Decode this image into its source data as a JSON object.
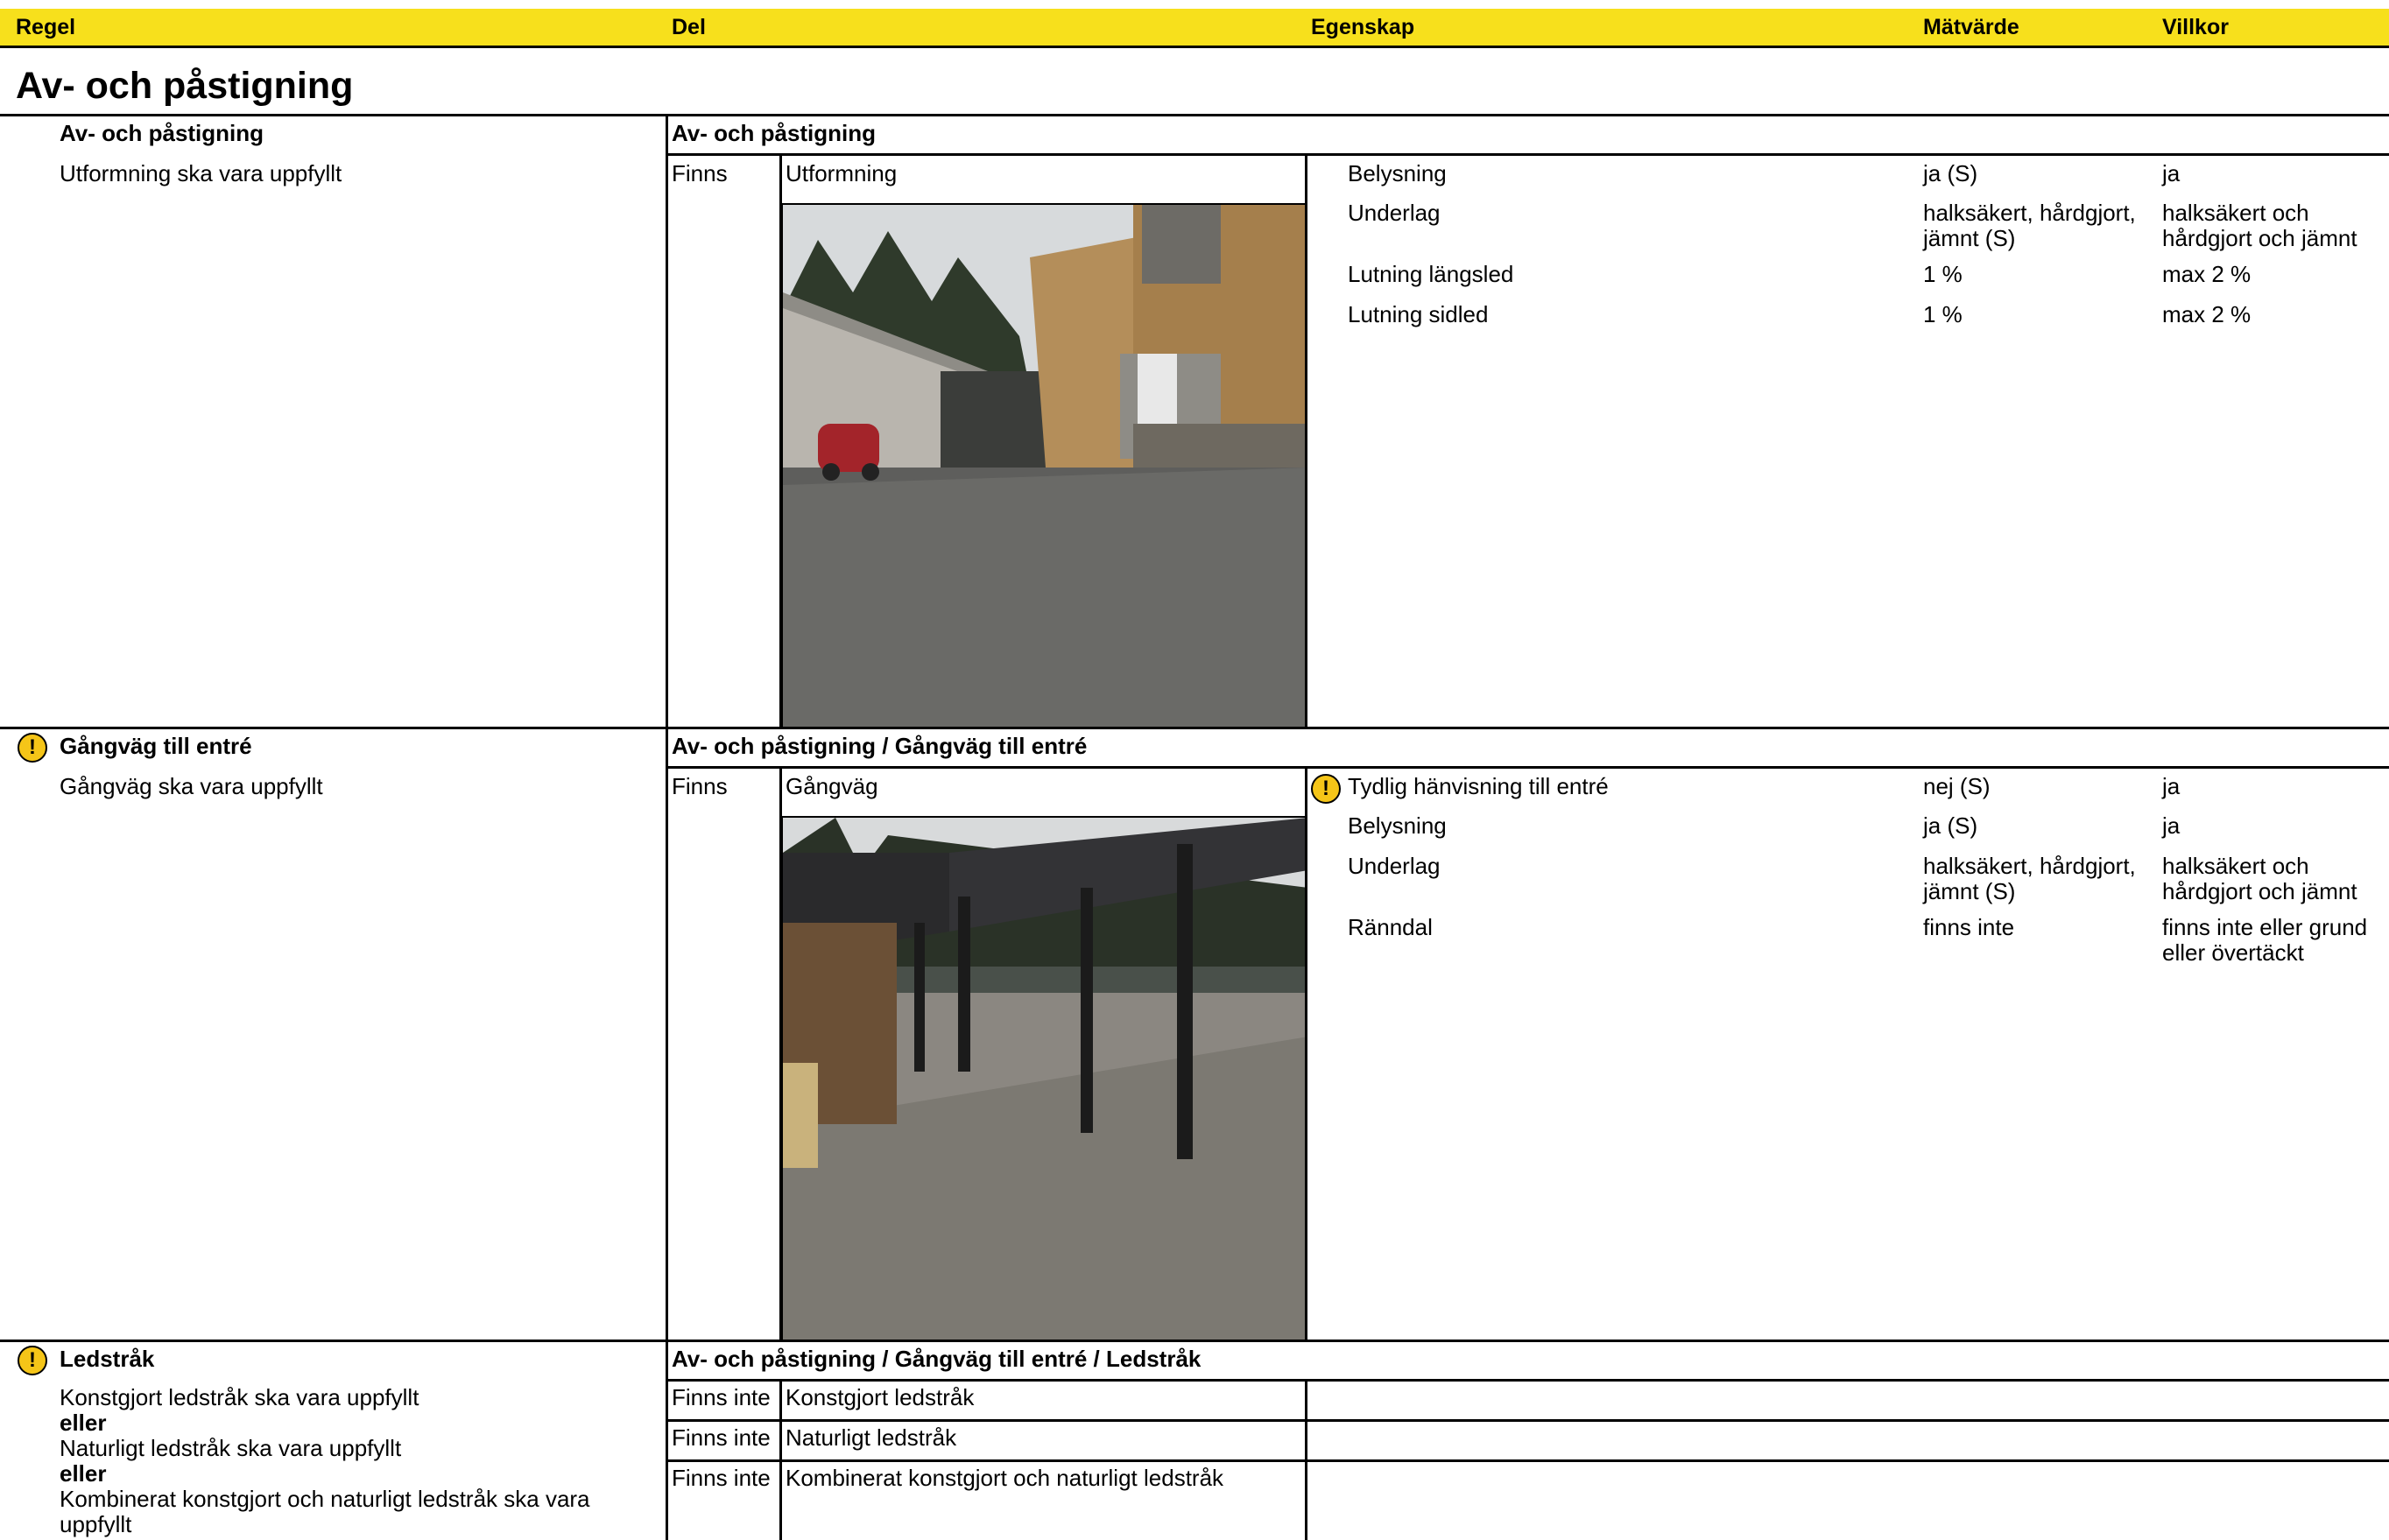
{
  "header": {
    "regel": "Regel",
    "del": "Del",
    "egenskap": "Egenskap",
    "matvarde": "Mätvärde",
    "villkor": "Villkor"
  },
  "section_title": "Av- och påstigning",
  "colors": {
    "header_bg": "#f7e01c",
    "warning": "#f5c518"
  },
  "rules": [
    {
      "title": "Av- och påstigning",
      "text": "Utformning ska vara uppfyllt",
      "path": "Av- och påstigning",
      "status": "Finns",
      "part": "Utformning",
      "properties": [
        {
          "name": "Belysning",
          "value": "ja (S)",
          "cond": "ja"
        },
        {
          "name": "Underlag",
          "value": "halksäkert, hårdgjort,",
          "value2": "jämnt (S)",
          "cond": "halksäkert och",
          "cond2": "hårdgjort och jämnt"
        },
        {
          "name": "Lutning längsled",
          "value": "1 %",
          "cond": "max 2 %"
        },
        {
          "name": "Lutning sidled",
          "value": "1 %",
          "cond": "max 2 %"
        }
      ]
    },
    {
      "title": "Gångväg till entré",
      "text": "Gångväg ska vara uppfyllt",
      "path": "Av- och påstigning / Gångväg till entré",
      "status": "Finns",
      "part": "Gångväg",
      "properties": [
        {
          "name": "Tydlig hänvisning till entré",
          "value": "nej (S)",
          "cond": "ja"
        },
        {
          "name": "Belysning",
          "value": "ja (S)",
          "cond": "ja"
        },
        {
          "name": "Underlag",
          "value": "halksäkert, hårdgjort,",
          "value2": "jämnt (S)",
          "cond": "halksäkert och",
          "cond2": "hårdgjort och jämnt"
        },
        {
          "name": "Ränndal",
          "value": "finns inte",
          "cond": "finns inte eller grund",
          "cond2": "eller övertäckt"
        }
      ]
    },
    {
      "title": "Ledstråk",
      "lines": [
        "Konstgjort ledstråk ska vara uppfyllt",
        "eller",
        "Naturligt ledstråk ska vara uppfyllt",
        "eller",
        "Kombinerat konstgjort och naturligt ledstråk ska vara",
        "uppfyllt"
      ],
      "path": "Av- och påstigning / Gångväg till entré / Ledstråk",
      "rows": [
        {
          "status": "Finns inte",
          "part": "Konstgjort ledstråk"
        },
        {
          "status": "Finns inte",
          "part": "Naturligt ledstråk"
        },
        {
          "status": "Finns inte",
          "part": "Kombinerat konstgjort och naturligt ledstråk"
        }
      ]
    }
  ]
}
